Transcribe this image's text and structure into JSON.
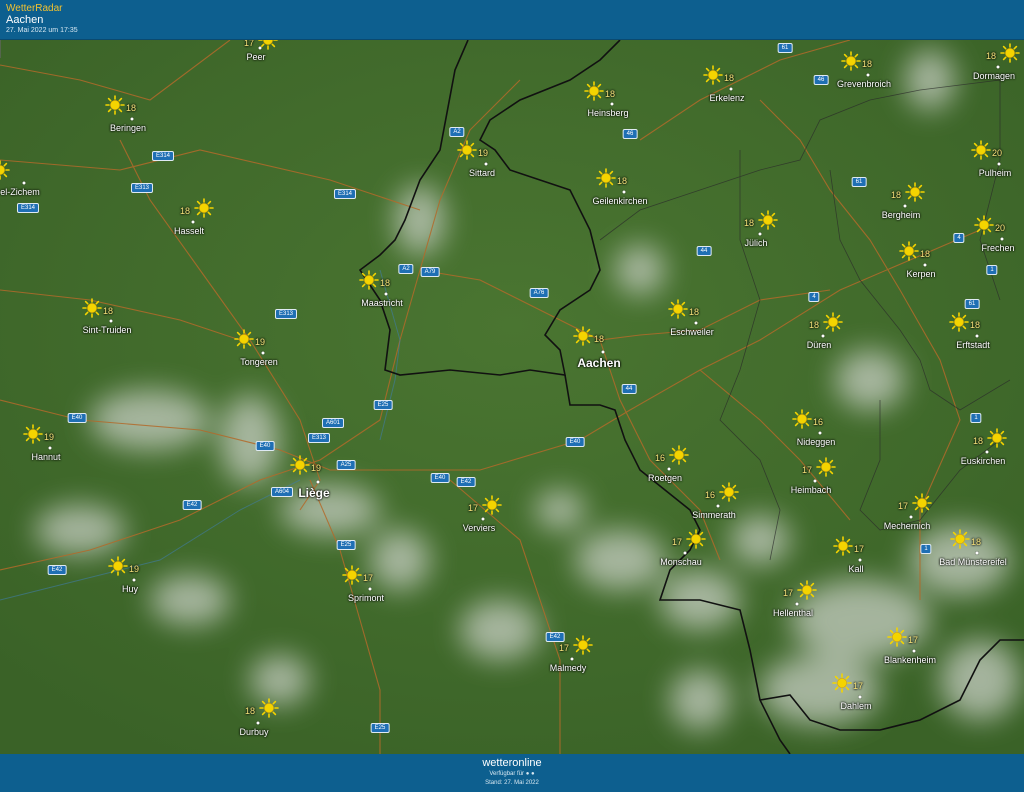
{
  "header": {
    "app_name": "WetterRadar",
    "location": "Aachen",
    "timestamp": "27. Mai 2022 um 17:35"
  },
  "footer": {
    "brand": "wetteronline",
    "available": "Verfügbar für",
    "stand": "Stand: 27. Mai 2022"
  },
  "colors": {
    "header_bg": "#0d5f8f",
    "land": "#3f6a2a",
    "temp_text": "#f6e27a",
    "sun": "#f4d400",
    "road_label": "#1f6fb4",
    "pin": "#e01b1b"
  },
  "icons": [
    "sun-icon",
    "location-pin-icon",
    "apple-icon",
    "android-icon"
  ],
  "cities": [
    {
      "name": "Peer",
      "temp": "17"
    },
    {
      "name": "Beringen",
      "temp": "18"
    },
    {
      "name": "Hasselt",
      "temp": "18"
    },
    {
      "name": "el-Zichem",
      "temp": ""
    },
    {
      "name": "Sint-Truiden",
      "temp": "18"
    },
    {
      "name": "Tongeren",
      "temp": "19"
    },
    {
      "name": "Hannut",
      "temp": "19"
    },
    {
      "name": "Liège",
      "temp": "19"
    },
    {
      "name": "Huy",
      "temp": "19"
    },
    {
      "name": "Sprimont",
      "temp": "17"
    },
    {
      "name": "Durbuy",
      "temp": "18"
    },
    {
      "name": "Sittard",
      "temp": "19"
    },
    {
      "name": "Maastricht",
      "temp": "18"
    },
    {
      "name": "Verviers",
      "temp": "17"
    },
    {
      "name": "Malmedy",
      "temp": "17"
    },
    {
      "name": "Heinsberg",
      "temp": "18"
    },
    {
      "name": "Geilenkirchen",
      "temp": "18"
    },
    {
      "name": "Erkelenz",
      "temp": "18"
    },
    {
      "name": "Aachen",
      "temp": "18"
    },
    {
      "name": "Eschweiler",
      "temp": "18"
    },
    {
      "name": "Roetgen",
      "temp": "16"
    },
    {
      "name": "Simmerath",
      "temp": "16"
    },
    {
      "name": "Monschau",
      "temp": "17"
    },
    {
      "name": "Hellenthal",
      "temp": "17"
    },
    {
      "name": "Jülich",
      "temp": "18"
    },
    {
      "name": "Düren",
      "temp": "18"
    },
    {
      "name": "Nideggen",
      "temp": "16"
    },
    {
      "name": "Heimbach",
      "temp": "17"
    },
    {
      "name": "Mechernich",
      "temp": "17"
    },
    {
      "name": "Kall",
      "temp": "17"
    },
    {
      "name": "Blankenheim",
      "temp": "17"
    },
    {
      "name": "Dahlem",
      "temp": "17"
    },
    {
      "name": "Grevenbroich",
      "temp": "18"
    },
    {
      "name": "Dormagen",
      "temp": "18"
    },
    {
      "name": "Bergheim",
      "temp": "18"
    },
    {
      "name": "Pulheim",
      "temp": "20"
    },
    {
      "name": "Kerpen",
      "temp": "18"
    },
    {
      "name": "Frechen",
      "temp": "20"
    },
    {
      "name": "Erftstadt",
      "temp": "18"
    },
    {
      "name": "Euskirchen",
      "temp": "18"
    },
    {
      "name": "Bad Münstereifel",
      "temp": "18"
    }
  ],
  "roads": [
    "E314",
    "E313",
    "E314",
    "E314",
    "E313",
    "E40",
    "E40",
    "A601",
    "E313",
    "A25",
    "A604",
    "E42",
    "E42",
    "E25",
    "E25",
    "E40",
    "E42",
    "E25",
    "A2",
    "A2",
    "A79",
    "A76",
    "E40",
    "E42",
    "46",
    "61",
    "46",
    "44",
    "4",
    "44",
    "61",
    "4",
    "1",
    "61",
    "1",
    "1"
  ]
}
